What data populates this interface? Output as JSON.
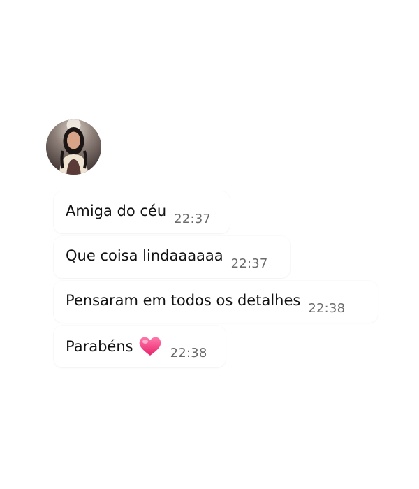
{
  "avatar": {
    "icon": "profile-photo"
  },
  "messages": [
    {
      "text": "Amiga do céu",
      "time": "22:37",
      "emoji": ""
    },
    {
      "text": "Que coisa lindaaaaaa",
      "time": "22:37",
      "emoji": ""
    },
    {
      "text": "Pensaram em todos os detalhes",
      "time": "22:38",
      "emoji": ""
    },
    {
      "text": "Parabéns",
      "time": "22:38",
      "emoji": "heart-icon"
    }
  ],
  "colors": {
    "background": "#ffffff",
    "bubble": "#ffffff",
    "text": "#111111",
    "time": "#6b6b6b",
    "heart": "#f0327a"
  }
}
